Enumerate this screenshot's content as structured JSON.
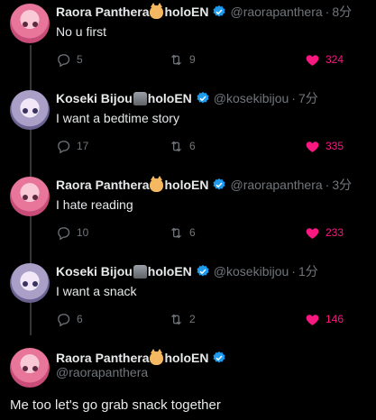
{
  "tweets": [
    {
      "display_name": "Raora Panthera",
      "suffix": "holoEN",
      "emoji": "cat-face-icon",
      "handle": "@raorapanthera",
      "sep": "·",
      "time": "8分",
      "text": "No u first",
      "replies": "5",
      "retweets": "9",
      "likes": "324"
    },
    {
      "display_name": "Koseki Bijou",
      "suffix": "holoEN",
      "emoji": "moai-icon",
      "handle": "@kosekibijou",
      "sep": "·",
      "time": "7分",
      "text": "I want a bedtime story",
      "replies": "17",
      "retweets": "6",
      "likes": "335"
    },
    {
      "display_name": "Raora Panthera",
      "suffix": "holoEN",
      "emoji": "cat-face-icon",
      "handle": "@raorapanthera",
      "sep": "·",
      "time": "3分",
      "text": "I hate reading",
      "replies": "10",
      "retweets": "6",
      "likes": "233"
    },
    {
      "display_name": "Koseki Bijou",
      "suffix": "holoEN",
      "emoji": "moai-icon",
      "handle": "@kosekibijou",
      "sep": "·",
      "time": "1分",
      "text": "I want a snack",
      "replies": "6",
      "retweets": "2",
      "likes": "146"
    }
  ],
  "focused": {
    "display_name": "Raora Panthera",
    "suffix": "holoEN",
    "emoji": "cat-face-icon",
    "handle": "@raorapanthera",
    "text": "Me too let's go grab snack together"
  },
  "colors": {
    "background": "#000000",
    "text": "#e7e9ea",
    "muted": "#71767b",
    "like": "#f91880",
    "verified": "#1d9bf0",
    "thread_line": "#333639"
  }
}
